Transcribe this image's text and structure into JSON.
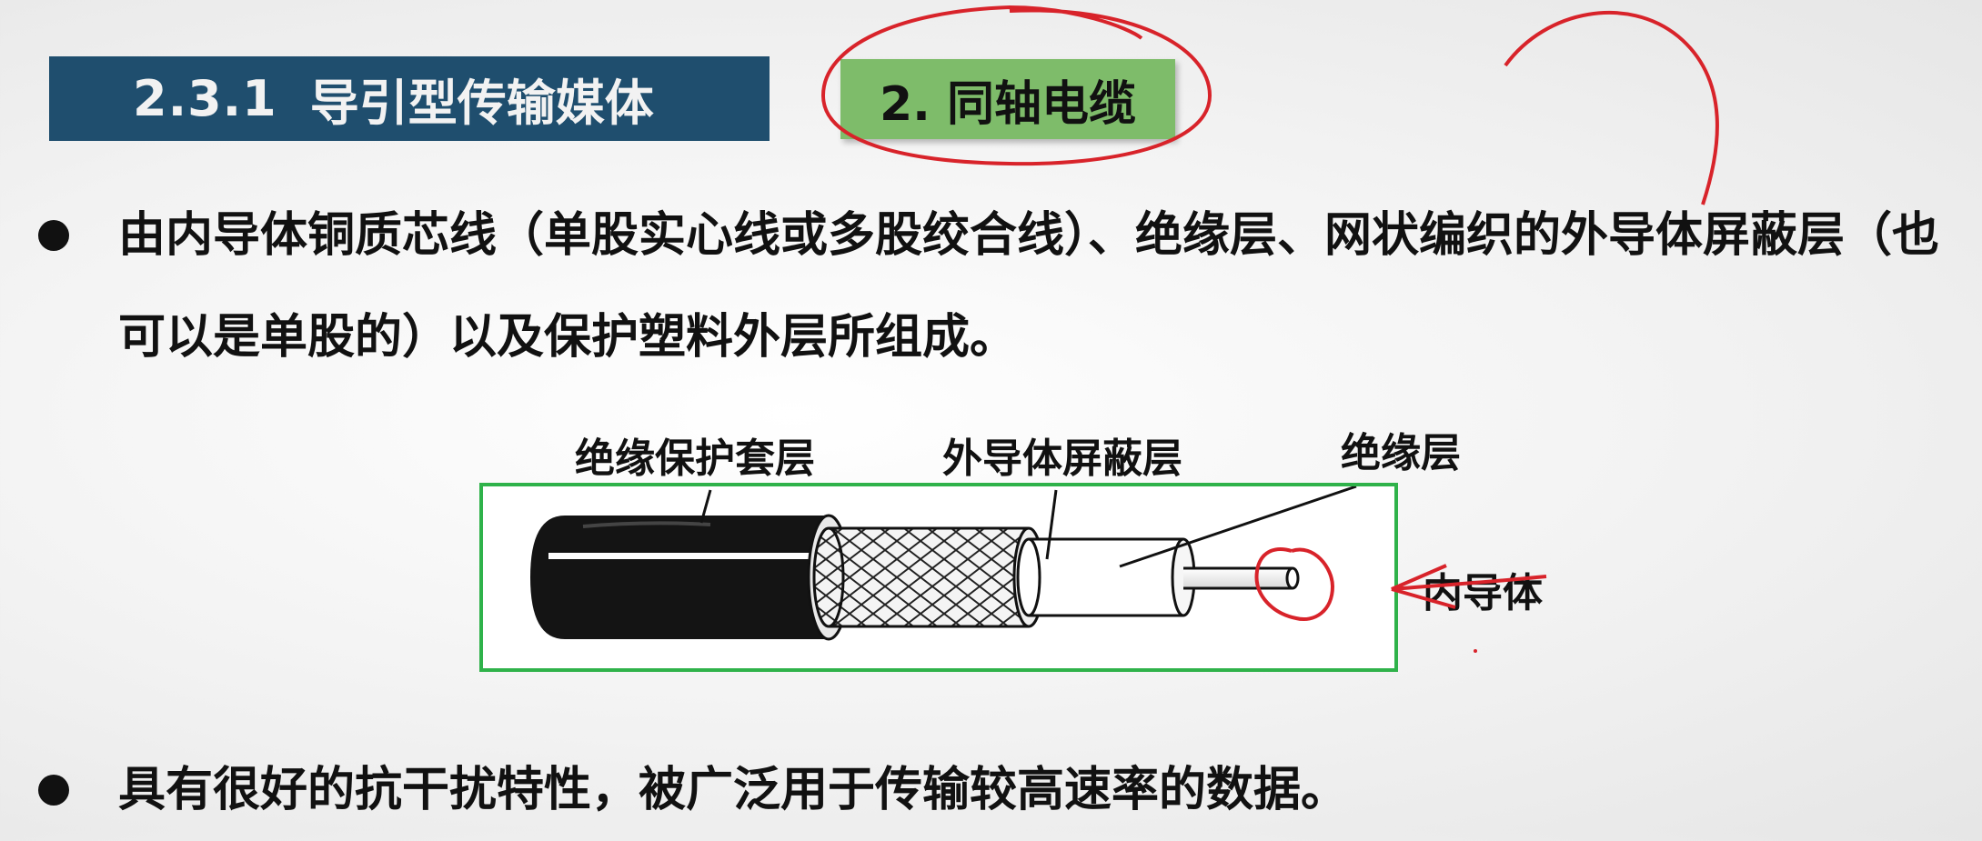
{
  "header": {
    "section_number": "2.3.1",
    "section_title": "导引型传输媒体",
    "topic": "2. 同轴电缆"
  },
  "bullets": [
    "由内导体铜质芯线（单股实心线或多股绞合线）、绝缘层、网状编织的外导体屏蔽层（也可以是单股的）以及保护塑料外层所组成。",
    "具有很好的抗干扰特性，被广泛用于传输较高速率的数据。"
  ],
  "diagram": {
    "labels": {
      "jacket": "绝缘保护套层",
      "shield": "外导体屏蔽层",
      "insulation": "绝缘层",
      "inner_conductor": "内导体"
    },
    "frame_color": "#2fb24a"
  },
  "annotation_color": "#d8232a"
}
